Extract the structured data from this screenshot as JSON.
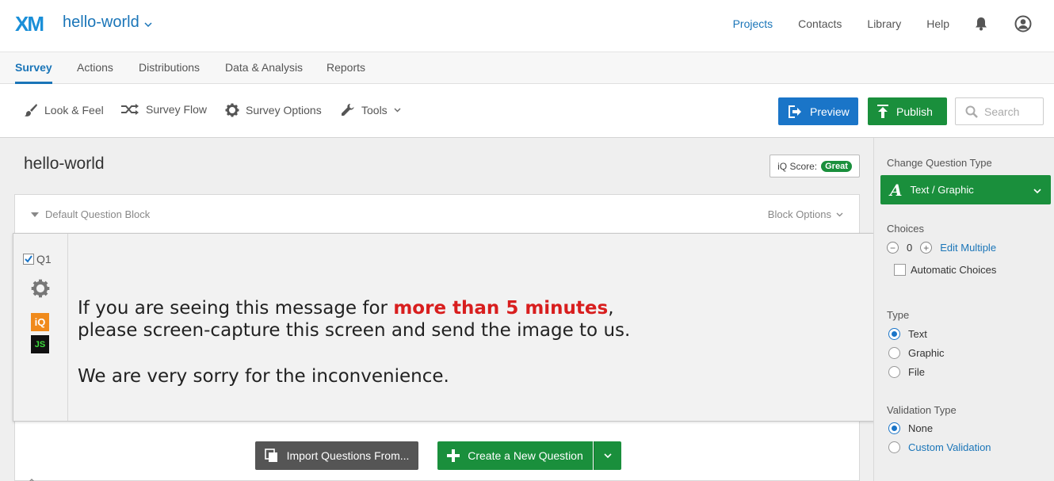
{
  "header": {
    "logo": "XM",
    "project_title": "hello-world",
    "nav": [
      "Projects",
      "Contacts",
      "Library",
      "Help"
    ]
  },
  "tabs": [
    "Survey",
    "Actions",
    "Distributions",
    "Data & Analysis",
    "Reports"
  ],
  "toolbar": {
    "look_feel": "Look & Feel",
    "survey_flow": "Survey Flow",
    "survey_options": "Survey Options",
    "tools": "Tools",
    "preview": "Preview",
    "publish": "Publish",
    "search_placeholder": "Search"
  },
  "canvas": {
    "survey_title": "hello-world",
    "iq_score_label": "iQ Score:",
    "iq_score_value": "Great",
    "block_name": "Default Question Block",
    "block_options": "Block Options",
    "question": {
      "id": "Q1",
      "iq_label": "iQ",
      "js_label": "JS",
      "line1_pre": "If you are seeing this message for ",
      "line1_highlight": "more than 5 minutes",
      "line1_post": ",",
      "line2": "please screen-capture this screen and send the image to us.",
      "line3": "We are very sorry for the inconvenience."
    },
    "import_button": "Import Questions From...",
    "create_button": "Create a New Question"
  },
  "panel": {
    "change_type_label": "Change Question Type",
    "question_type": "Text / Graphic",
    "choices_label": "Choices",
    "choices_count": "0",
    "edit_multiple": "Edit Multiple",
    "automatic_choices": "Automatic Choices",
    "type_label": "Type",
    "type_options": [
      "Text",
      "Graphic",
      "File"
    ],
    "type_selected": "Text",
    "validation_label": "Validation Type",
    "validation_options": [
      "None",
      "Custom Validation"
    ],
    "validation_selected": "None"
  },
  "colors": {
    "accent_blue": "#1a75c8",
    "publish_green": "#1a8f3c",
    "highlight_red": "#d81e1e"
  }
}
